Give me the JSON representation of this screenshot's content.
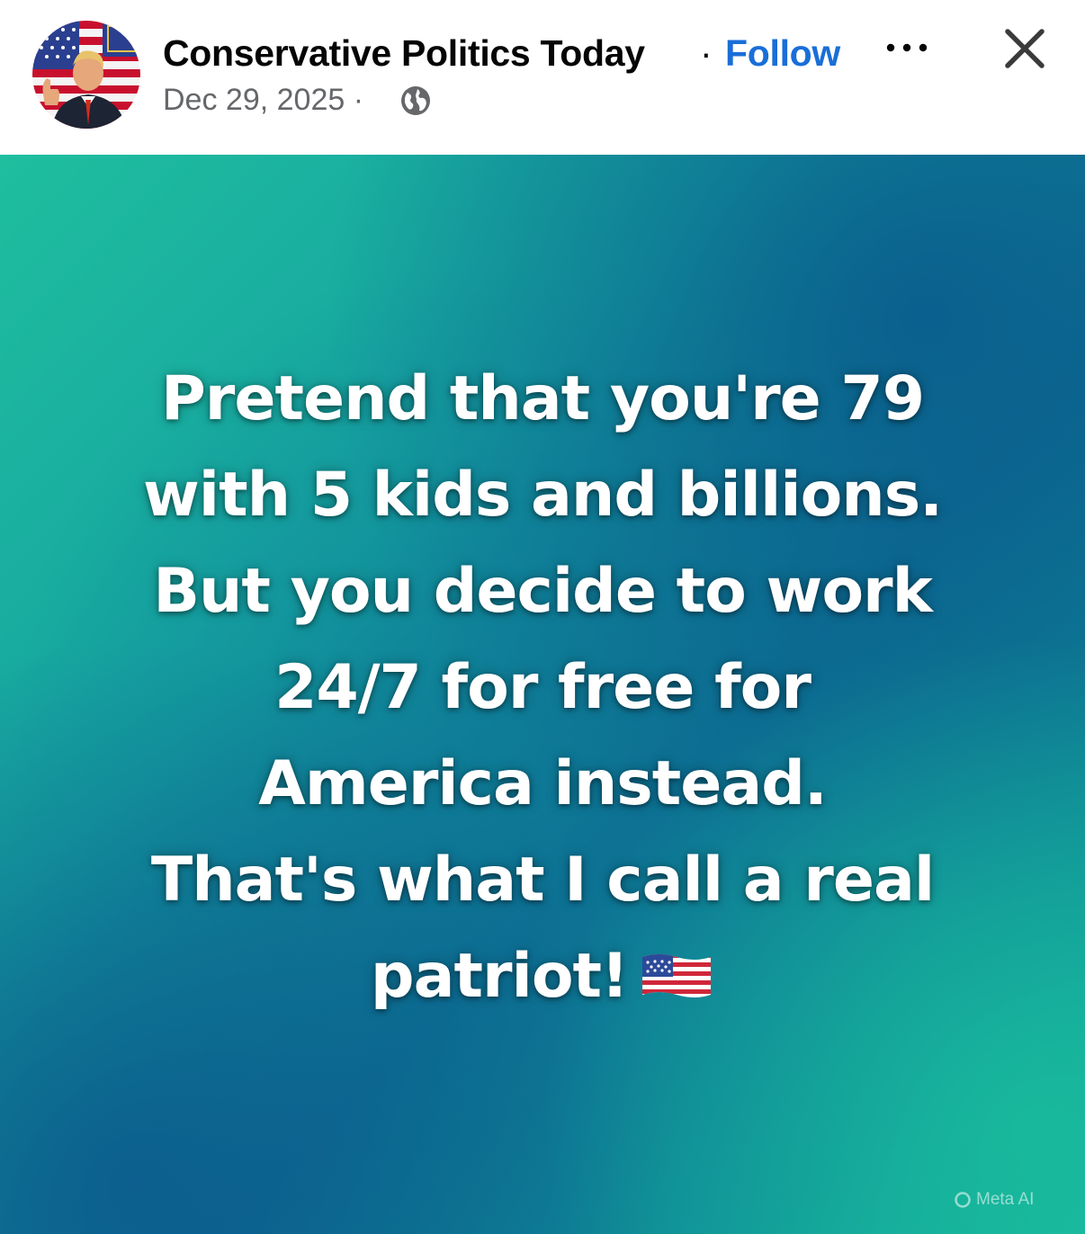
{
  "header": {
    "page_name": "Conservative Politics Today",
    "separator": "·",
    "follow_label": "Follow",
    "date": "Dec 29, 2025 ·",
    "more_icon": "more-horizontal-icon",
    "close_icon": "close-icon",
    "audience_icon": "globe-icon"
  },
  "post": {
    "lines": [
      "Pretend that you're 79",
      "with 5 kids and billions.",
      "But you decide to work",
      "24/7 for free for",
      "America instead.",
      "That's what I call a real",
      "patriot!"
    ],
    "emoji_icon": "us-flag-icon",
    "watermark": "Meta AI"
  },
  "colors": {
    "follow": "#1a6ed8",
    "name_text": "#050505",
    "meta_text": "#65676b",
    "bg_teal": "#14b39e",
    "bg_blue": "#0a5f8f"
  }
}
